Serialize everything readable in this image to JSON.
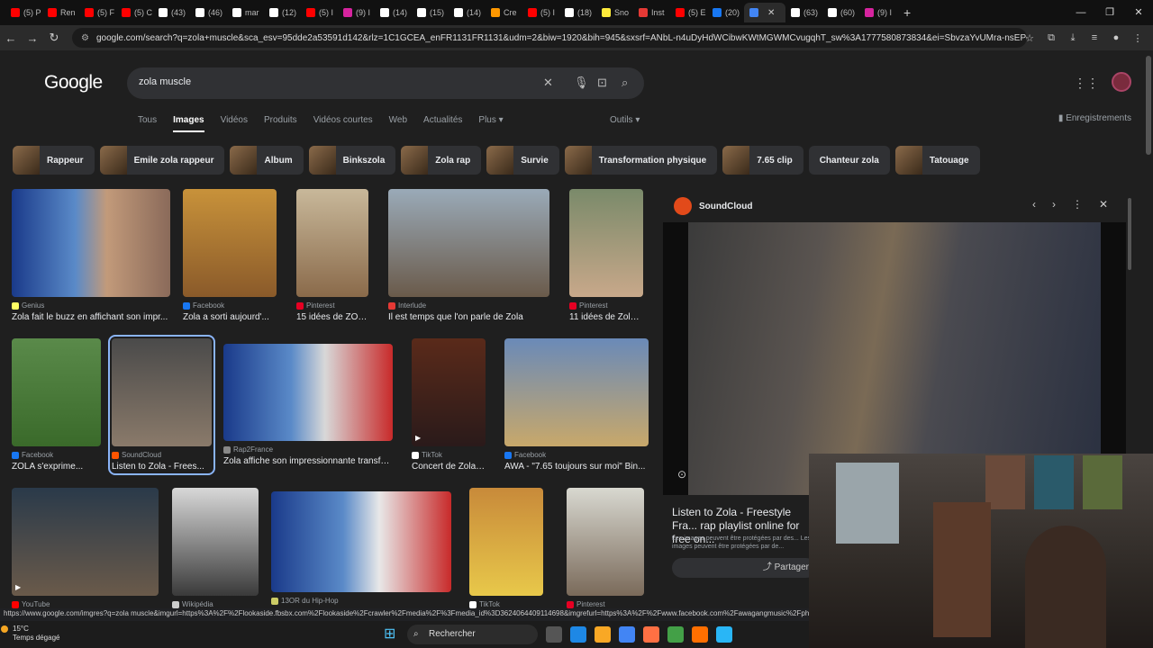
{
  "browser": {
    "tabs": [
      {
        "label": "(5) P",
        "color": "#ff0000"
      },
      {
        "label": "Ren",
        "color": "#ff0000"
      },
      {
        "label": "(5) F",
        "color": "#ff0000"
      },
      {
        "label": "(5) C",
        "color": "#ff0000"
      },
      {
        "label": "(43)",
        "color": "#ffffff"
      },
      {
        "label": "(46)",
        "color": "#ffffff"
      },
      {
        "label": "mar",
        "color": "#ffffff"
      },
      {
        "label": "(12)",
        "color": "#ffffff"
      },
      {
        "label": "(5) I",
        "color": "#ff0000"
      },
      {
        "label": "(9) I",
        "color": "#d6249f"
      },
      {
        "label": "(14)",
        "color": "#ffffff"
      },
      {
        "label": "(15)",
        "color": "#ffffff"
      },
      {
        "label": "(14)",
        "color": "#ffffff"
      },
      {
        "label": "Cre",
        "color": "#ff9800"
      },
      {
        "label": "(5) I",
        "color": "#ff0000"
      },
      {
        "label": "(18)",
        "color": "#ffffff"
      },
      {
        "label": "Sno",
        "color": "#ffeb3b"
      },
      {
        "label": "Inst",
        "color": "#e53935"
      },
      {
        "label": "(5) E",
        "color": "#ff0000"
      },
      {
        "label": "(20)",
        "color": "#1877f2"
      },
      {
        "label": "",
        "color": "#4285f4",
        "active": true
      },
      {
        "label": "(63)",
        "color": "#ffffff"
      },
      {
        "label": "(60)",
        "color": "#ffffff"
      },
      {
        "label": "(9) I",
        "color": "#d6249f"
      }
    ],
    "new_tab": "+",
    "url": "google.com/search?q=zola+muscle&sca_esv=95dde2a53591d142&rlz=1C1GCEA_enFR1131FR1131&udm=2&biw=1920&bih=945&sxsrf=ANbL-n4uDyHdWCibwKWtMGWMCvugqhT_sw%3A1777580873834&ei=SbvzaYvUMra-nsEPqInJKQ&ve..."
  },
  "google": {
    "logo": "Google",
    "query": "zola muscle",
    "tabs": [
      "Tous",
      "Images",
      "Vidéos",
      "Produits",
      "Vidéos courtes",
      "Web",
      "Actualités",
      "Plus ▾"
    ],
    "active_tab": "Images",
    "tools": "Outils ▾",
    "saved": "Enregistrements"
  },
  "chips": [
    "Rappeur",
    "Emile zola rappeur",
    "Album",
    "Binkszola",
    "Zola rap",
    "Survie",
    "Transformation physique",
    "7.65 clip",
    "Chanteur zola",
    "Tatouage"
  ],
  "results": [
    {
      "source": "Genius",
      "caption": "Zola fait le buzz en affichant son impr...",
      "color": "#ffff64"
    },
    {
      "source": "Facebook",
      "caption": "Zola a sorti aujourd'...",
      "color": "#1877f2"
    },
    {
      "source": "Pinterest",
      "caption": "15 idées de ZOLA ...",
      "color": "#e60023"
    },
    {
      "source": "Interlude",
      "caption": "Il est temps que l'on parle de Zola",
      "color": "#e53935"
    },
    {
      "source": "Pinterest",
      "caption": "11 idées de Zola | r...",
      "color": "#e60023"
    },
    {
      "source": "Facebook",
      "caption": "ZOLA s'exprime...",
      "color": "#1877f2"
    },
    {
      "source": "SoundCloud",
      "caption": "Listen to Zola - Frees...",
      "color": "#ff5500"
    },
    {
      "source": "Rap2France",
      "caption": "Zola affiche son impressionnante transfo...",
      "color": "#888888"
    },
    {
      "source": "TikTok",
      "caption": "Concert de Zola à ...",
      "color": "#ffffff"
    },
    {
      "source": "Facebook",
      "caption": "AWA - \"7.65 toujours sur moi\" Bin...",
      "color": "#1877f2"
    },
    {
      "source": "YouTube",
      "caption": "",
      "color": "#ff0000"
    },
    {
      "source": "Wikipédia",
      "caption": "",
      "color": "#cccccc"
    },
    {
      "source": "13OR du Hip-Hop",
      "caption": "",
      "color": "#cccc66"
    },
    {
      "source": "TikTok",
      "caption": "",
      "color": "#ffffff"
    },
    {
      "source": "Pinterest",
      "caption": "",
      "color": "#e60023"
    }
  ],
  "panel": {
    "source": "SoundCloud",
    "title": "Listen to Zola - Freestyle Fra... rap playlist online for free on...",
    "note": "Les images peuvent être protégées par des... Les images peuvent être protégées par de...",
    "share": "Partager"
  },
  "status_url": "https://www.google.com/imgres?q=zola muscle&imgurl=https%3A%2F%2Flookaside.fbsbx.com%2Flookaside%2Fcrawler%2Fmedia%2F%3Fmedia_id%3D3624064409114698&imgrefurl=https%3A%2F%2Fwww.facebook.com%2Fawagangmusic%2Fphotos%2F",
  "taskbar": {
    "temperature": "15°C",
    "weather": "Temps dégagé",
    "search": "Rechercher"
  }
}
